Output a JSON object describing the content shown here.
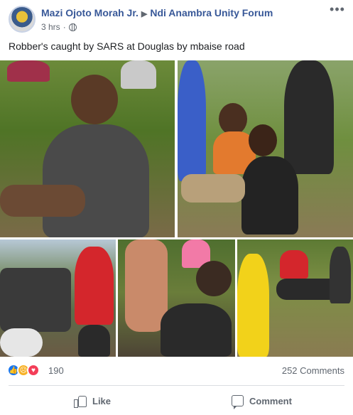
{
  "post": {
    "author": "Mazi Ojoto Morah Jr.",
    "group": "Ndi Anambra Unity Forum",
    "timestamp": "3 hrs",
    "separator": "·",
    "privacy_icon": "globe-icon",
    "more_icon": "more-icon",
    "text": "Robber's caught by SARS at Douglas by mbaise road"
  },
  "reactions": {
    "icons": [
      "like-icon",
      "sad-icon",
      "love-icon"
    ],
    "count": "190",
    "comments": "252 Comments"
  },
  "actions": {
    "like_label": "Like",
    "comment_label": "Comment"
  },
  "colors": {
    "link": "#385898",
    "meta": "#606770",
    "like_blue": "#1877f2",
    "love_red": "#f33e58",
    "sad_yellow": "#f7b125"
  }
}
